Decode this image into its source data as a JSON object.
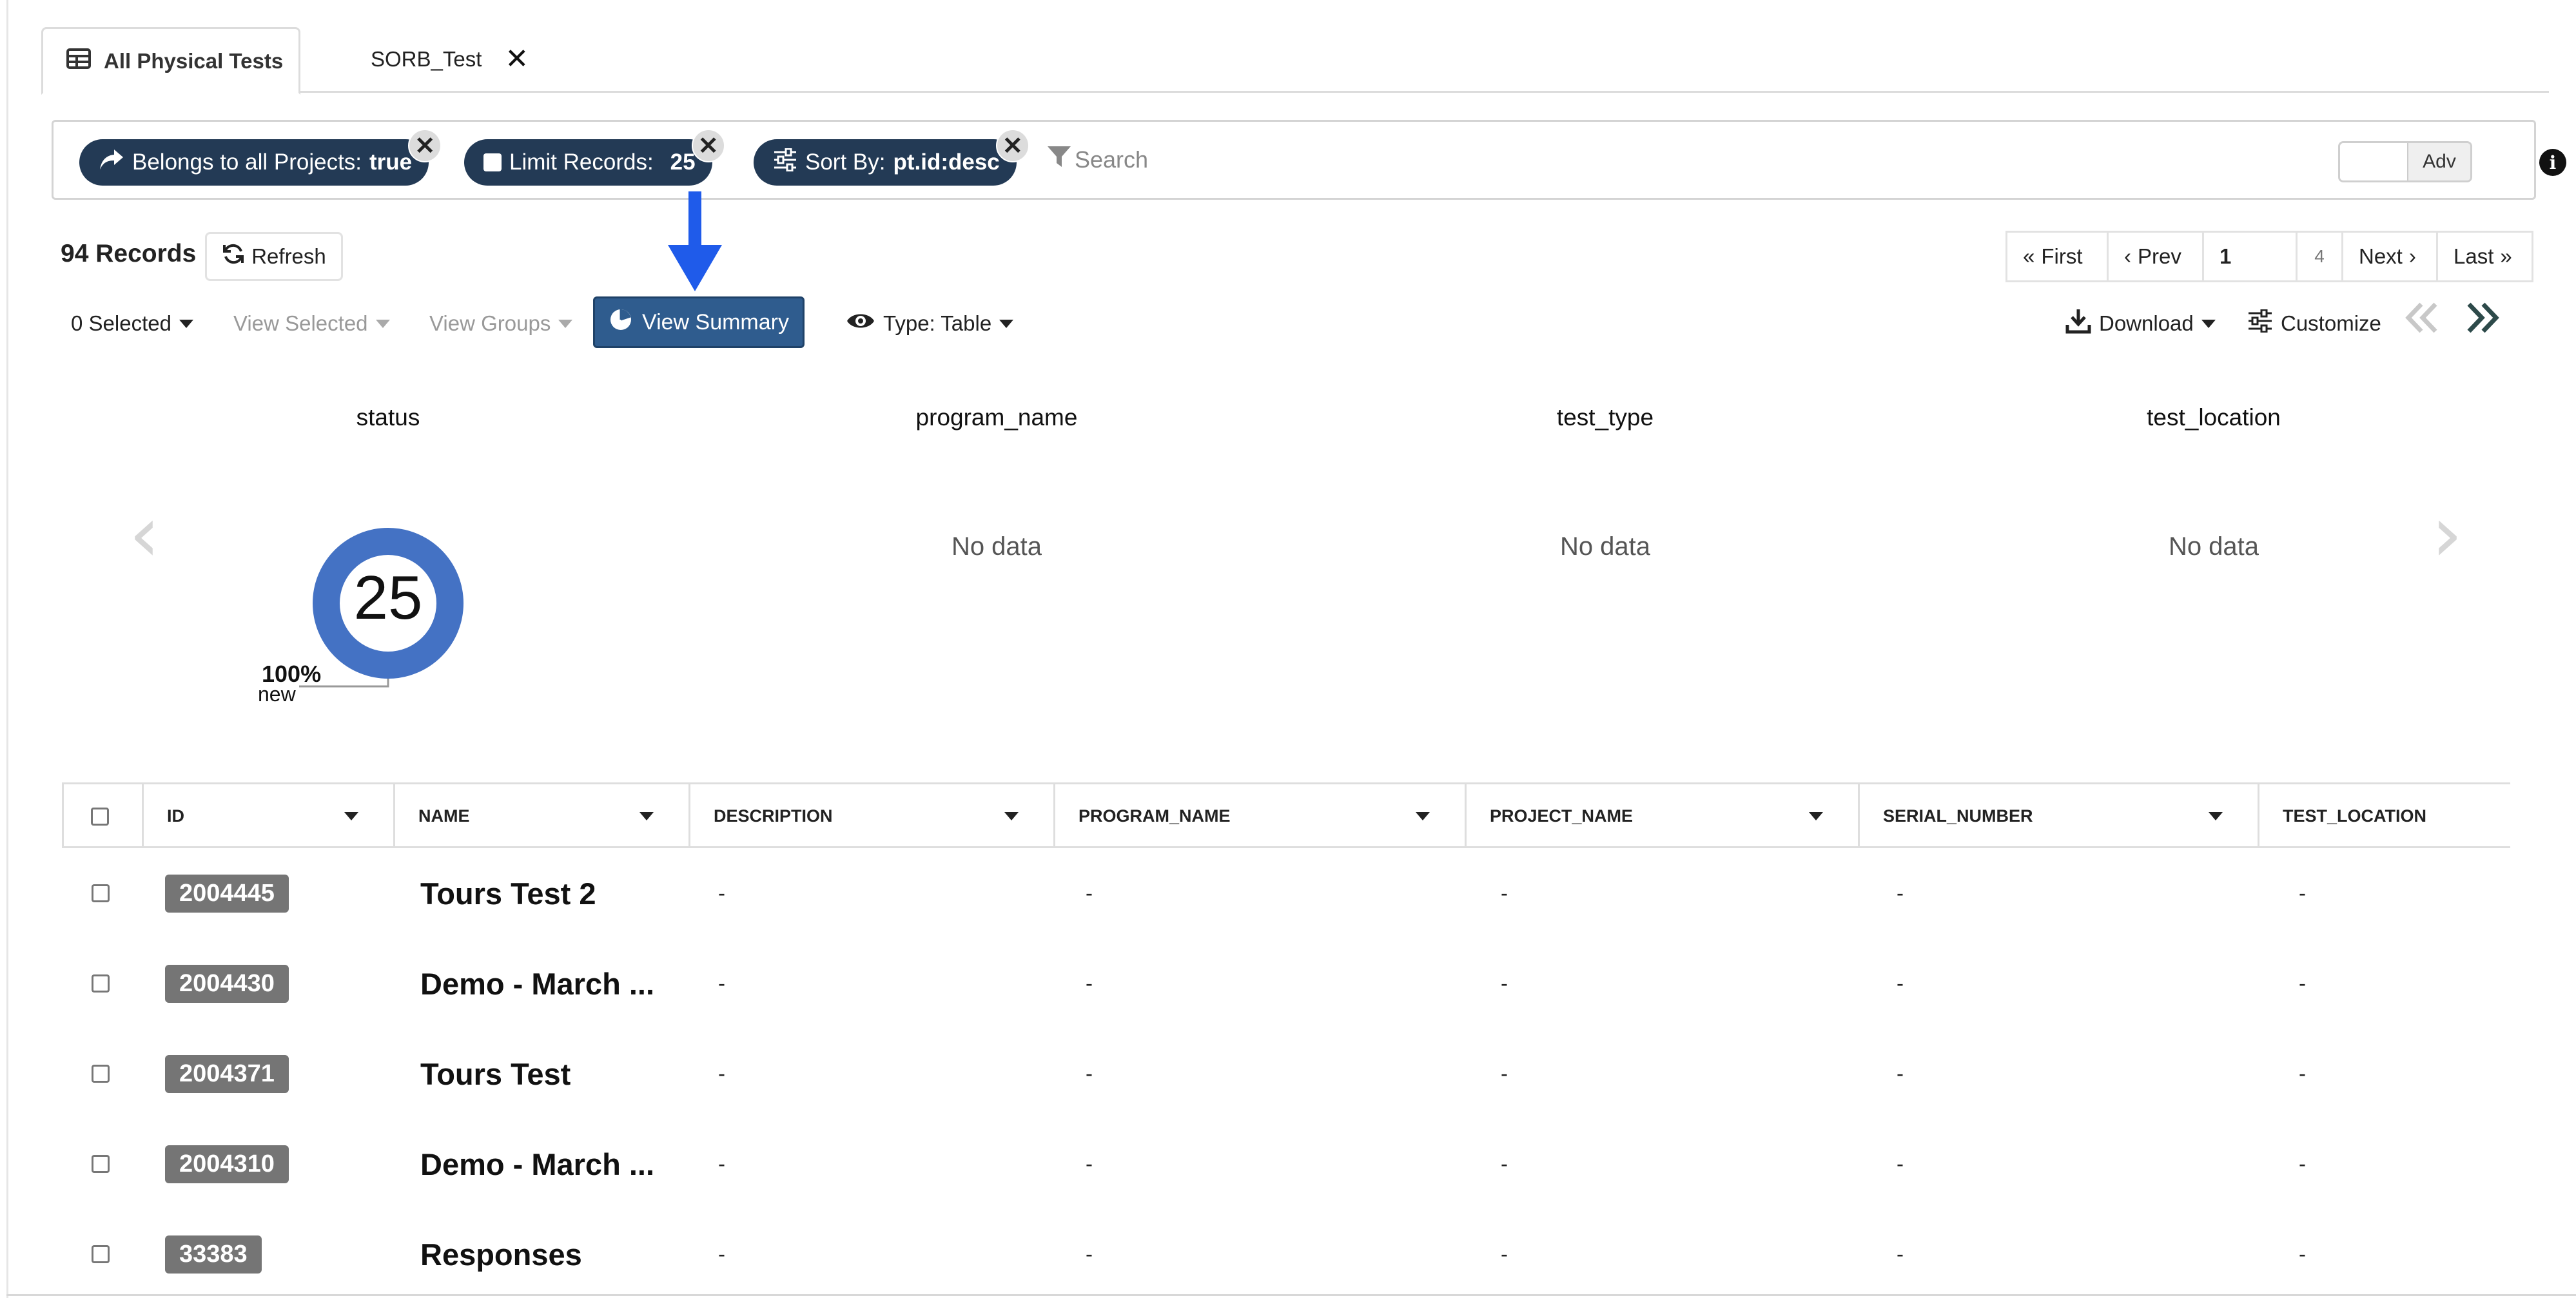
{
  "tabs": [
    {
      "label": "All Physical Tests",
      "active": true
    },
    {
      "label": "SORB_Test",
      "active": false
    }
  ],
  "filters": {
    "pill1": {
      "label": "Belongs to all Projects:",
      "value": "true"
    },
    "pill2": {
      "label": "Limit Records:",
      "value": "25"
    },
    "pill3": {
      "label": "Sort By:",
      "value": "pt.id:desc"
    },
    "search_placeholder": "Search",
    "adv_label": "Adv"
  },
  "records": {
    "count_label": "94 Records",
    "refresh_label": "Refresh"
  },
  "pager": {
    "first": "First",
    "prev": "Prev",
    "page": "1",
    "total": "4",
    "next": "Next",
    "last": "Last"
  },
  "toolbar": {
    "selected": "0 Selected",
    "view_selected": "View Selected",
    "view_groups": "View Groups",
    "view_summary": "View Summary",
    "type": "Type: Table",
    "download": "Download",
    "customize": "Customize"
  },
  "summary": {
    "charts": [
      {
        "title": "status",
        "center": "25",
        "slices": [
          {
            "label": "new",
            "percent": "100%",
            "count": 25
          }
        ]
      },
      {
        "title": "program_name",
        "empty": "No data"
      },
      {
        "title": "test_type",
        "empty": "No data"
      },
      {
        "title": "test_location",
        "empty": "No data"
      }
    ]
  },
  "table": {
    "columns": [
      "ID",
      "NAME",
      "DESCRIPTION",
      "PROGRAM_NAME",
      "PROJECT_NAME",
      "SERIAL_NUMBER",
      "TEST_LOCATION"
    ],
    "rows": [
      {
        "id": "2004445",
        "name": "Tours Test 2",
        "description": "-",
        "program_name": "-",
        "project_name": "-",
        "serial_number": "-",
        "test_location": "-"
      },
      {
        "id": "2004430",
        "name": "Demo - March ...",
        "description": "-",
        "program_name": "-",
        "project_name": "-",
        "serial_number": "-",
        "test_location": "-"
      },
      {
        "id": "2004371",
        "name": "Tours Test",
        "description": "-",
        "program_name": "-",
        "project_name": "-",
        "serial_number": "-",
        "test_location": "-"
      },
      {
        "id": "2004310",
        "name": "Demo - March ...",
        "description": "-",
        "program_name": "-",
        "project_name": "-",
        "serial_number": "-",
        "test_location": "-"
      },
      {
        "id": "33383",
        "name": "Responses",
        "description": "-",
        "program_name": "-",
        "project_name": "-",
        "serial_number": "-",
        "test_location": "-"
      }
    ]
  },
  "colors": {
    "pill_bg": "#233a55",
    "primary_button": "#2f5c8e",
    "donut": "#4472c4",
    "annotation_arrow": "#1f5bea",
    "id_badge": "#757575"
  }
}
